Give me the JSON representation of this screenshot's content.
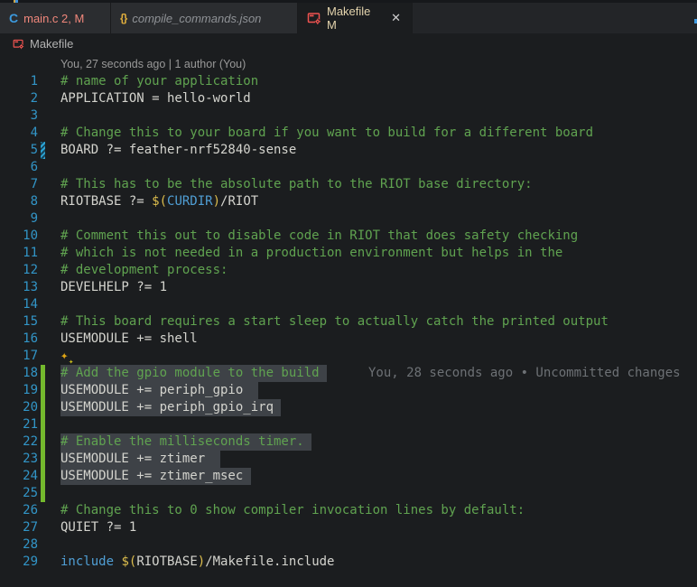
{
  "window": {
    "app": "code-editor"
  },
  "colors": {
    "editor_bg": "#1b1d1f",
    "tabbar_bg": "#232528",
    "inactive_tab_bg": "#2b2d30",
    "selection_bg": "#3e4247",
    "comment_green": "#60a350",
    "plain_text": "#d4d4ce",
    "keyword_blue": "#509fd5",
    "punct_yellow": "#dcbd4d",
    "line_number_blue": "#3295c7",
    "added_gutter_green": "#74b92d",
    "modified_gutter_blue": "#2ba3d4",
    "tab_error_red": "#f0877b",
    "tab_modified_cream": "#e3d3ac",
    "makefile_icon_red": "#ef5350"
  },
  "tabs": [
    {
      "id": "main-c",
      "icon": "c-language-icon",
      "icon_glyph": "C",
      "label": "main.c 2, M",
      "state": "inactive"
    },
    {
      "id": "compile-commands",
      "icon": "json-icon",
      "icon_glyph": "{}",
      "label": "compile_commands.json",
      "state": "inactive-preview"
    },
    {
      "id": "makefile",
      "icon": "makefile-icon",
      "label": "Makefile M",
      "state": "active",
      "close_glyph": "✕"
    }
  ],
  "breadcrumb": {
    "icon": "makefile-icon",
    "label": "Makefile"
  },
  "codelens": {
    "text": "You, 27 seconds ago | 1 author (You)"
  },
  "editor": {
    "sparkle_glyph": "✦",
    "lines": [
      {
        "n": 1,
        "tokens": [
          {
            "s": "c",
            "t": "# name of your application"
          }
        ]
      },
      {
        "n": 2,
        "tokens": [
          {
            "s": "p",
            "t": "APPLICATION = hello-world"
          }
        ]
      },
      {
        "n": 3,
        "tokens": []
      },
      {
        "n": 4,
        "tokens": [
          {
            "s": "c",
            "t": "# Change this to your board if you want to build for a different board"
          }
        ]
      },
      {
        "n": 5,
        "modified": true,
        "tokens": [
          {
            "s": "p",
            "t": "BOARD ?= feather-nrf52840-sense"
          }
        ]
      },
      {
        "n": 6,
        "tokens": []
      },
      {
        "n": 7,
        "tokens": [
          {
            "s": "c",
            "t": "# This has to be the absolute path to the RIOT base directory:"
          }
        ]
      },
      {
        "n": 8,
        "tokens": [
          {
            "s": "p",
            "t": "RIOTBASE ?= "
          },
          {
            "s": "y",
            "t": "$("
          },
          {
            "s": "b",
            "t": "CURDIR"
          },
          {
            "s": "y",
            "t": ")"
          },
          {
            "s": "p",
            "t": "/RIOT"
          }
        ]
      },
      {
        "n": 9,
        "tokens": []
      },
      {
        "n": 10,
        "tokens": [
          {
            "s": "c",
            "t": "# Comment this out to disable code in RIOT that does safety checking"
          }
        ]
      },
      {
        "n": 11,
        "tokens": [
          {
            "s": "c",
            "t": "# which is not needed in a production environment but helps in the"
          }
        ]
      },
      {
        "n": 12,
        "tokens": [
          {
            "s": "c",
            "t": "# development process:"
          }
        ]
      },
      {
        "n": 13,
        "tokens": [
          {
            "s": "p",
            "t": "DEVELHELP ?= 1"
          }
        ]
      },
      {
        "n": 14,
        "tokens": []
      },
      {
        "n": 15,
        "tokens": [
          {
            "s": "c",
            "t": "# This board requires a start sleep to actually catch the printed output"
          }
        ]
      },
      {
        "n": 16,
        "tokens": [
          {
            "s": "p",
            "t": "USEMODULE += shell"
          }
        ]
      },
      {
        "n": 17,
        "sparkle": true,
        "tokens": []
      },
      {
        "n": 18,
        "added": true,
        "sel": true,
        "selExtra": 1,
        "blame": "You, 28 seconds ago • Uncommitted changes",
        "tokens": [
          {
            "s": "c",
            "t": "# Add the gpio module to the build"
          }
        ]
      },
      {
        "n": 19,
        "added": true,
        "sel": true,
        "selExtra": 2,
        "tokens": [
          {
            "s": "p",
            "t": "USEMODULE += periph_gpio"
          }
        ]
      },
      {
        "n": 20,
        "added": true,
        "sel": true,
        "selExtra": 1,
        "tokens": [
          {
            "s": "p",
            "t": "USEMODULE += periph_gpio_irq"
          }
        ]
      },
      {
        "n": 21,
        "added": true,
        "sel": true,
        "selExtra": 6,
        "tokens": []
      },
      {
        "n": 22,
        "added": true,
        "sel": true,
        "selExtra": 1,
        "tokens": [
          {
            "s": "c",
            "t": "# Enable the milliseconds timer."
          }
        ]
      },
      {
        "n": 23,
        "added": true,
        "sel": true,
        "selExtra": 2,
        "tokens": [
          {
            "s": "p",
            "t": "USEMODULE += ztimer"
          }
        ]
      },
      {
        "n": 24,
        "added": true,
        "sel": true,
        "selExtra": 1,
        "tokens": [
          {
            "s": "p",
            "t": "USEMODULE += ztimer_msec"
          }
        ]
      },
      {
        "n": 25,
        "added": true,
        "tokens": []
      },
      {
        "n": 26,
        "tokens": [
          {
            "s": "c",
            "t": "# Change this to 0 show compiler invocation lines by default:"
          }
        ]
      },
      {
        "n": 27,
        "tokens": [
          {
            "s": "p",
            "t": "QUIET ?= 1"
          }
        ]
      },
      {
        "n": 28,
        "tokens": []
      },
      {
        "n": 29,
        "tokens": [
          {
            "s": "k",
            "t": "include"
          },
          {
            "s": "p",
            "t": " "
          },
          {
            "s": "y",
            "t": "$("
          },
          {
            "s": "p",
            "t": "RIOTBASE"
          },
          {
            "s": "y",
            "t": ")"
          },
          {
            "s": "p",
            "t": "/Makefile.include"
          }
        ]
      }
    ]
  }
}
